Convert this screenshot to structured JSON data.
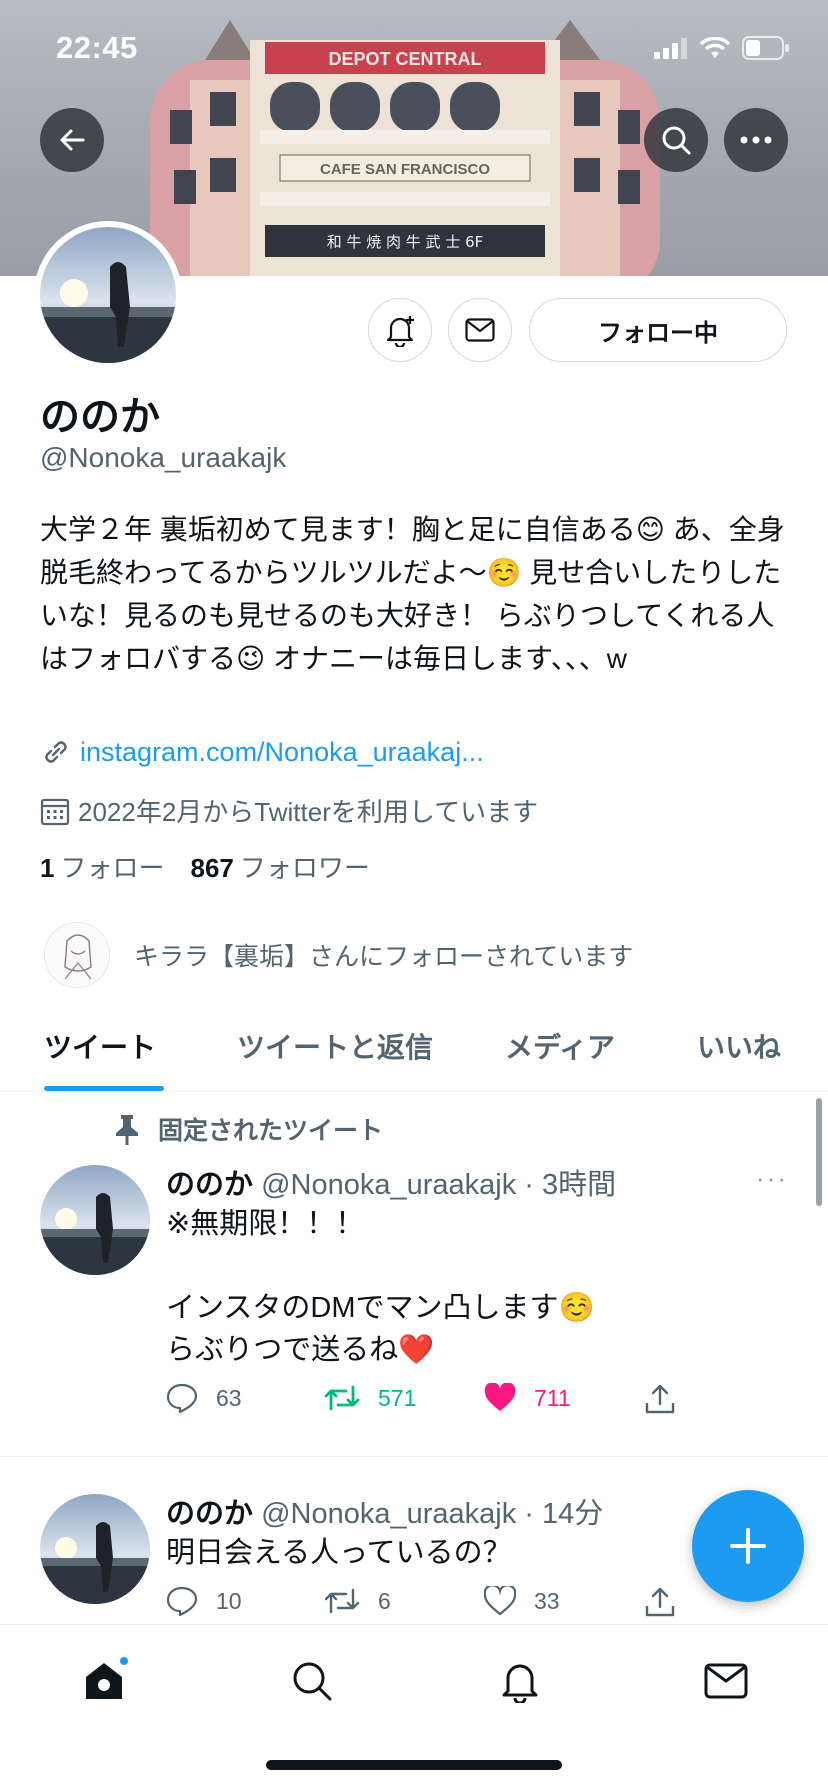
{
  "status_bar": {
    "time": "22:45"
  },
  "banner": {
    "sign_top": "DEPOT CENTRAL",
    "sign_mid": "CAFE SAN FRANCISCO",
    "sign_low": "和 牛  焼 肉  牛 武 士 6F"
  },
  "header": {
    "back_icon": "back-arrow-icon",
    "search_icon": "search-icon",
    "more_icon": "more-horizontal-icon"
  },
  "profile": {
    "name": "ののか",
    "handle": "@Nonoka_uraakajk",
    "follow_button": "フォロー中",
    "bio": "大学２年 裏垢初めて見ます！胸と足に自信ある😊 あ、全身脱毛終わってるからツルツルだよ〜☺️ 見せ合いしたりしたいな！見るのも見せるのも大好き！ らぶりつしてくれる人はフォロバする😉 オナニーは毎日します、、、w",
    "link": "instagram.com/Nonoka_uraakaj...",
    "joined": "2022年2月からTwitterを利用しています",
    "following_count": "1",
    "following_label": "フォロー",
    "followers_count": "867",
    "followers_label": "フォロワー",
    "followed_by": "キララ【裏垢】さんにフォローされています"
  },
  "tabs": [
    {
      "label": "ツイート",
      "active": true
    },
    {
      "label": "ツイートと返信",
      "active": false
    },
    {
      "label": "メディア",
      "active": false
    },
    {
      "label": "いいね",
      "active": false
    }
  ],
  "tweets": [
    {
      "pinned_label": "固定されたツイート",
      "name": "ののか",
      "meta": "@Nonoka_uraakajk · 3時間",
      "body": "※無期限！！！\n\nインスタのDMでマン凸します☺️\nらぶりつで送るね❤️",
      "replies": "63",
      "retweets": "571",
      "likes": "711",
      "more": "···"
    },
    {
      "name": "ののか",
      "meta": "@Nonoka_uraakajk · 14分",
      "body": "明日会える人っているの？",
      "replies": "10",
      "retweets": "6",
      "likes": "33"
    }
  ],
  "colors": {
    "accent": "#1d9bf0",
    "retweet": "#00ba7c",
    "like": "#f91880"
  },
  "bottom_nav": [
    "home-icon",
    "search-icon",
    "bell-icon",
    "mail-icon"
  ]
}
